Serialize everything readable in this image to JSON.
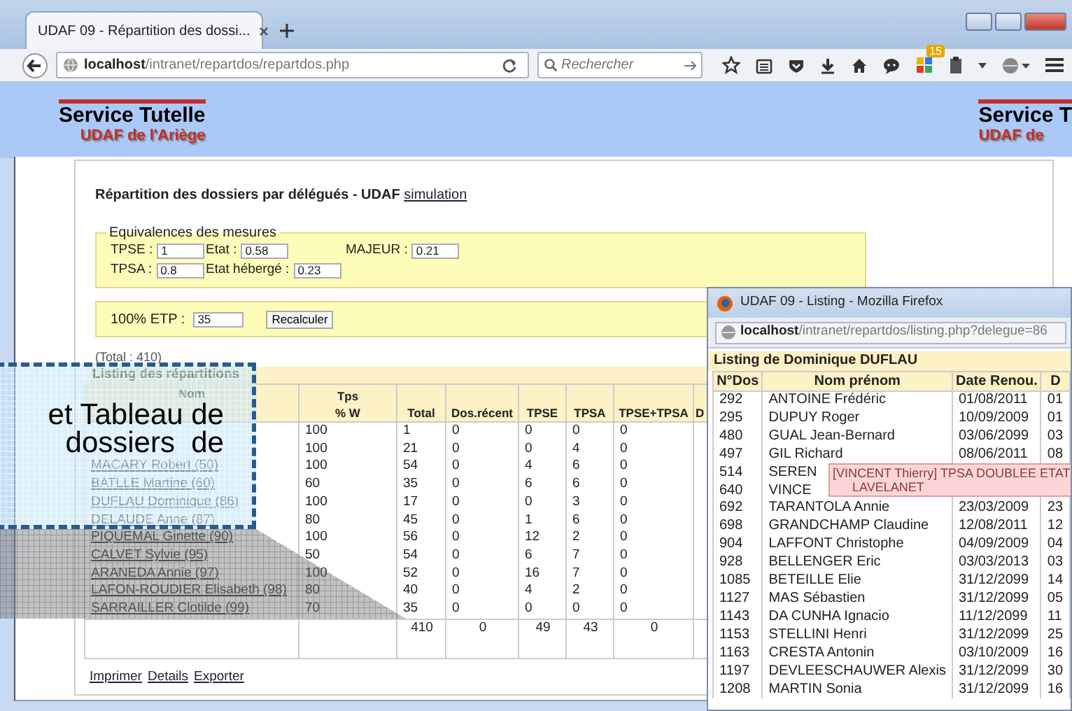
{
  "browser": {
    "tabs": [
      {
        "title": "UDAF 09 - Répartition des dossi...",
        "selected": true
      }
    ],
    "address": {
      "host": "localhost",
      "path": "/intranet/repartdos/repartdos.php"
    },
    "search": {
      "placeholder": "Rechercher"
    },
    "badge": "15"
  },
  "banner": {
    "logos": [
      {
        "title": "Service Tutelle",
        "subtitle": "UDAF de l'Ariège"
      },
      {
        "title": "Service T",
        "subtitle": "UDAF de"
      }
    ]
  },
  "page": {
    "title": "Répartition des dossiers par délégués - UDAF",
    "title_link": "simulation",
    "equivalences": {
      "legend": "Equivalences des mesures",
      "rows": [
        [
          {
            "label": "TPSE :",
            "value": "1"
          },
          {
            "label": "Etat :",
            "value": "0.58"
          },
          {
            "label": "MAJEUR :",
            "value": "0.21"
          }
        ],
        [
          {
            "label": "TPSA :",
            "value": "0.8"
          },
          {
            "label": "Etat hébergé :",
            "value": "0.23"
          }
        ]
      ]
    },
    "etp": {
      "label": "100% ETP :",
      "value": "35",
      "button": "Recalculer"
    },
    "total": "(Total : 410)",
    "table": {
      "caption": "Listing des répartitions",
      "columns": [
        {
          "label": "Nom"
        },
        {
          "label": "% W",
          "top": "Tps"
        },
        {
          "label": "Total"
        },
        {
          "label": "Dos.récent"
        },
        {
          "label": "TPSE"
        },
        {
          "label": "TPSA"
        },
        {
          "label": "TPSE+TPSA"
        },
        {
          "label": "D"
        }
      ],
      "rows": [
        {
          "cells": [
            null,
            "100",
            "1",
            "0",
            "0",
            "0",
            "0"
          ]
        },
        {
          "cells": [
            null,
            "100",
            "21",
            "0",
            "0",
            "4",
            "0"
          ]
        },
        {
          "cells": [
            "MACARY Robert (50)",
            "100",
            "54",
            "0",
            "4",
            "6",
            "0"
          ]
        },
        {
          "cells": [
            "BATLLE Martine (60)",
            "60",
            "35",
            "0",
            "6",
            "6",
            "0"
          ]
        },
        {
          "cells": [
            "DUFLAU Dominique (86)",
            "100",
            "17",
            "0",
            "0",
            "3",
            "0"
          ]
        },
        {
          "cells": [
            "DELAUDE Anne (87)",
            "80",
            "45",
            "0",
            "1",
            "6",
            "0"
          ]
        },
        {
          "cells": [
            "PIQUEMAL Ginette (90)",
            "100",
            "56",
            "0",
            "12",
            "2",
            "0"
          ]
        },
        {
          "cells": [
            "CALVET Sylvie (95)",
            "50",
            "54",
            "0",
            "6",
            "7",
            "0"
          ]
        },
        {
          "cells": [
            "ARANEDA Annie (97)",
            "100",
            "52",
            "0",
            "16",
            "7",
            "0"
          ]
        },
        {
          "cells": [
            "LAFON-ROUDIER Elisabeth (98)",
            "80",
            "40",
            "0",
            "4",
            "2",
            "0"
          ]
        },
        {
          "cells": [
            "SARRAILLER Clotilde (99)",
            "70",
            "35",
            "0",
            "0",
            "0",
            "0"
          ]
        }
      ],
      "totals": [
        "410",
        "0",
        "49",
        "43",
        "0"
      ]
    },
    "links": [
      "Imprimer",
      "Details",
      "Exporter"
    ]
  },
  "popup": {
    "title": "UDAF 09 - Listing - Mozilla Firefox",
    "address": {
      "host": "localhost",
      "path": "/intranet/repartdos/listing.php?delegue=86"
    },
    "heading": "Listing de Dominique DUFLAU",
    "columns": [
      "N°Dos",
      "Nom prénom",
      "Date Renou.",
      "D"
    ],
    "rows": [
      [
        "292",
        "ANTOINE Frédéric",
        "01/08/2011",
        "01"
      ],
      [
        "295",
        "DUPUY Roger",
        "10/09/2009",
        "01"
      ],
      [
        "480",
        "GUAL Jean-Bernard",
        "03/06/2099",
        "03"
      ],
      [
        "497",
        "GIL Richard",
        "08/06/2011",
        "08"
      ],
      [
        "514",
        "SEREN",
        "",
        ""
      ],
      [
        "640",
        "VINCE",
        "",
        ""
      ],
      [
        "692",
        "TARANTOLA Annie",
        "23/03/2009",
        "23"
      ],
      [
        "698",
        "GRANDCHAMP Claudine",
        "12/08/2011",
        "12"
      ],
      [
        "904",
        "LAFFONT Christophe",
        "04/09/2009",
        "04"
      ],
      [
        "928",
        "BELLENGER Eric",
        "03/03/2013",
        "03"
      ],
      [
        "1085",
        "BETEILLE Elie",
        "31/12/2099",
        "14"
      ],
      [
        "1127",
        "MAS Sébastien",
        "31/12/2099",
        "05"
      ],
      [
        "1143",
        "DA CUNHA Ignacio",
        "11/12/2099",
        "11"
      ],
      [
        "1153",
        "STELLINI Henri",
        "31/12/2099",
        "25"
      ],
      [
        "1163",
        "CRESTA Antonin",
        "03/10/2009",
        "16"
      ],
      [
        "1197",
        "DEVLEESCHAUWER Alexis",
        "31/12/2099",
        "30"
      ],
      [
        "1208",
        "MARTIN Sonia",
        "31/12/2099",
        "16"
      ]
    ],
    "tooltip": [
      "[VINCENT Thierry] TPSA DOUBLEE ETAT",
      "LAVELANET"
    ]
  },
  "callout": {
    "lines": [
      "et Tableau de",
      "dossiers  de"
    ]
  }
}
